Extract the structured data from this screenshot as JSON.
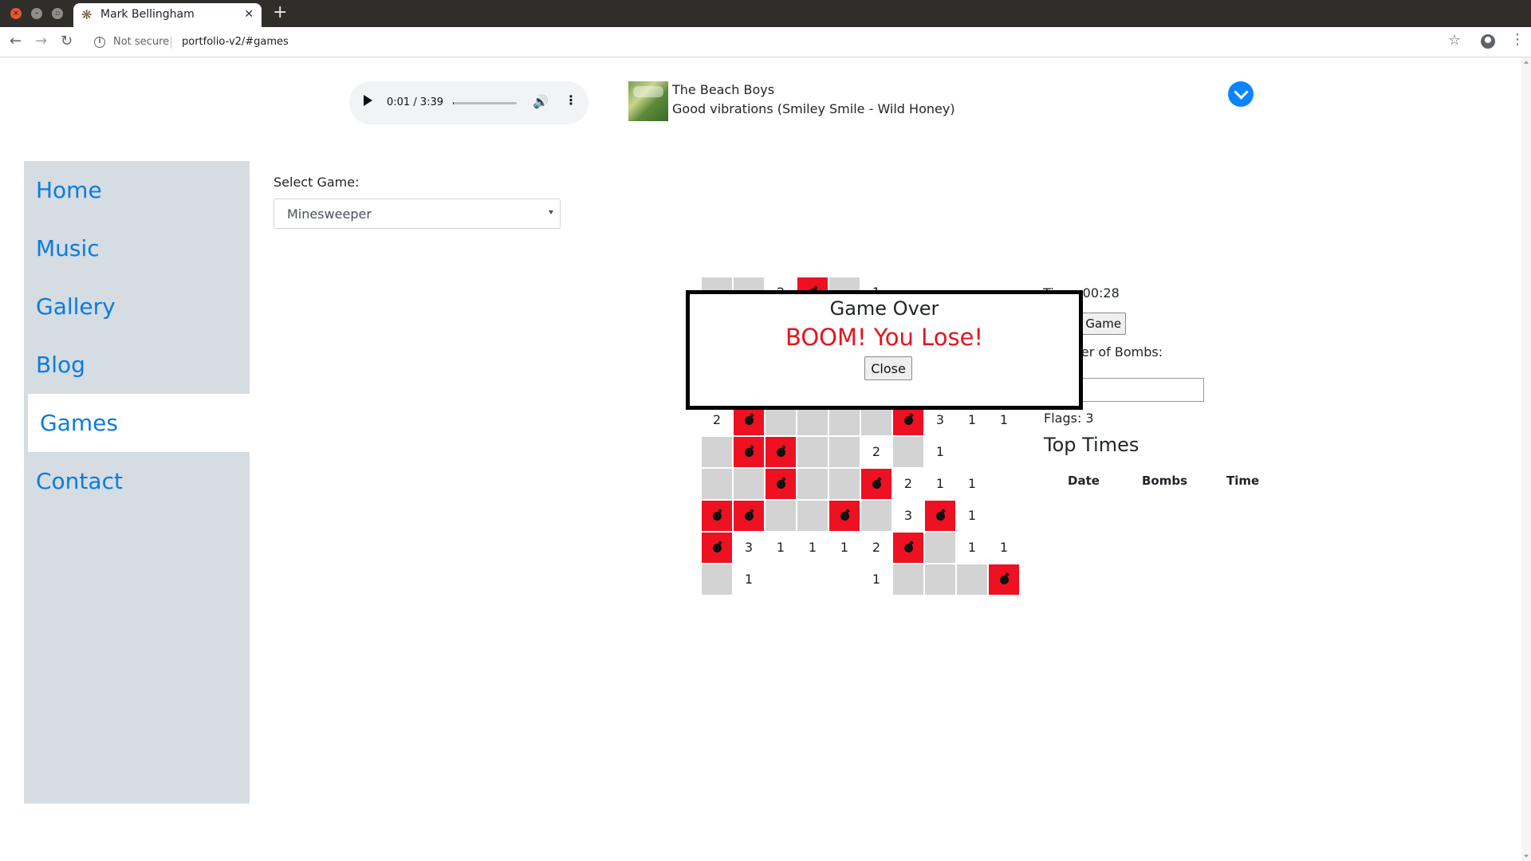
{
  "browser": {
    "tab_title": "Mark Bellingham",
    "security_label": "Not secure",
    "url": "portfolio-v2/#games"
  },
  "player": {
    "time": "0:01 / 3:39",
    "progress": 0.005,
    "artist": "The Beach Boys",
    "song": "Good vibrations (Smiley Smile - Wild Honey)"
  },
  "nav": {
    "items": [
      {
        "label": "Home",
        "active": false
      },
      {
        "label": "Music",
        "active": false
      },
      {
        "label": "Gallery",
        "active": false
      },
      {
        "label": "Blog",
        "active": false
      },
      {
        "label": "Games",
        "active": true
      },
      {
        "label": "Contact",
        "active": false
      }
    ]
  },
  "game_select": {
    "label": "Select Game:",
    "value": "Minesweeper"
  },
  "board": {
    "rows": [
      [
        "h",
        "h",
        "2",
        "b",
        "h",
        "1",
        "",
        "",
        "",
        ""
      ],
      [
        "",
        "",
        "",
        "",
        "",
        "",
        "",
        "",
        "",
        ""
      ],
      [
        "",
        "",
        "",
        "",
        "",
        "",
        "",
        "",
        "",
        ""
      ],
      [
        "",
        "",
        "",
        "",
        "",
        "",
        "",
        "",
        "",
        ""
      ],
      [
        "2",
        "b",
        "h",
        "h",
        "h",
        "h",
        "b",
        "3",
        "1",
        "1"
      ],
      [
        "h",
        "b",
        "b",
        "h",
        "h",
        "2",
        "h",
        "1",
        "",
        ""
      ],
      [
        "h",
        "h",
        "b",
        "h",
        "h",
        "b",
        "2",
        "1",
        "1",
        ""
      ],
      [
        "b",
        "b",
        "h",
        "h",
        "b",
        "h",
        "3",
        "b",
        "1",
        ""
      ],
      [
        "b",
        "3",
        "1",
        "1",
        "1",
        "2",
        "b",
        "h",
        "1",
        "1"
      ],
      [
        "h",
        "1",
        "",
        "",
        "",
        "1",
        "h",
        "h",
        "h",
        "b"
      ]
    ]
  },
  "side": {
    "timer": "Time: 00:28",
    "new_game_label": "New Game",
    "bombs_label": "Number of Bombs:",
    "bombs_value": "",
    "flags": "Flags: 3",
    "top_times_title": "Top Times",
    "columns": [
      "Date",
      "Bombs",
      "Time"
    ]
  },
  "modal": {
    "title": "Game Over",
    "message": "BOOM! You Lose!",
    "close_label": "Close"
  }
}
